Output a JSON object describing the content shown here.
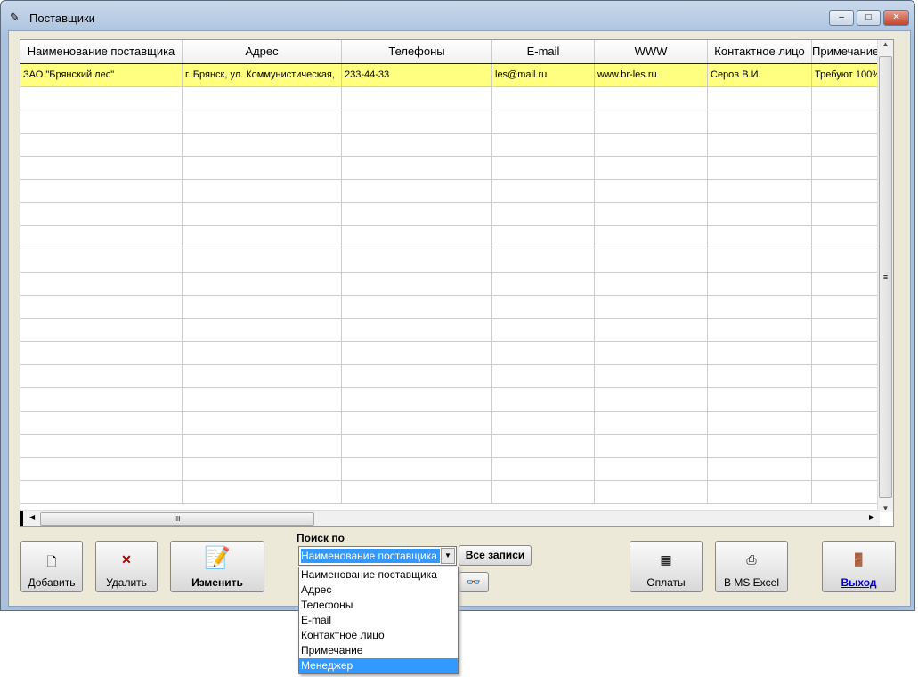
{
  "window": {
    "title": "Поставщики"
  },
  "columns": [
    "Наименование поставщика",
    "Адрес",
    "Телефоны",
    "E-mail",
    "WWW",
    "Контактное лицо",
    "Примечание"
  ],
  "rows": [
    [
      "ЗАО \"Брянский лес\"",
      "г. Брянск, ул. Коммунистическая,",
      "233-44-33",
      "les@mail.ru",
      "www.br-les.ru",
      "Серов В.И.",
      "Требуют 100%"
    ]
  ],
  "buttons": {
    "add": "Добавить",
    "delete": "Удалить",
    "edit": "Изменить",
    "payments": "Оплаты",
    "excel": "В MS Excel",
    "exit": "Выход",
    "all_records": "Все записи"
  },
  "search": {
    "label": "Поиск по",
    "selected": "Наименование поставщика",
    "options": [
      "Наименование поставщика",
      "Адрес",
      "Телефоны",
      "E-mail",
      "Контактное лицо",
      "Примечание",
      "Менеджер"
    ],
    "highlighted_index": 6
  },
  "colors": {
    "selected_row": "#ffff80",
    "highlight": "#3399ff"
  }
}
